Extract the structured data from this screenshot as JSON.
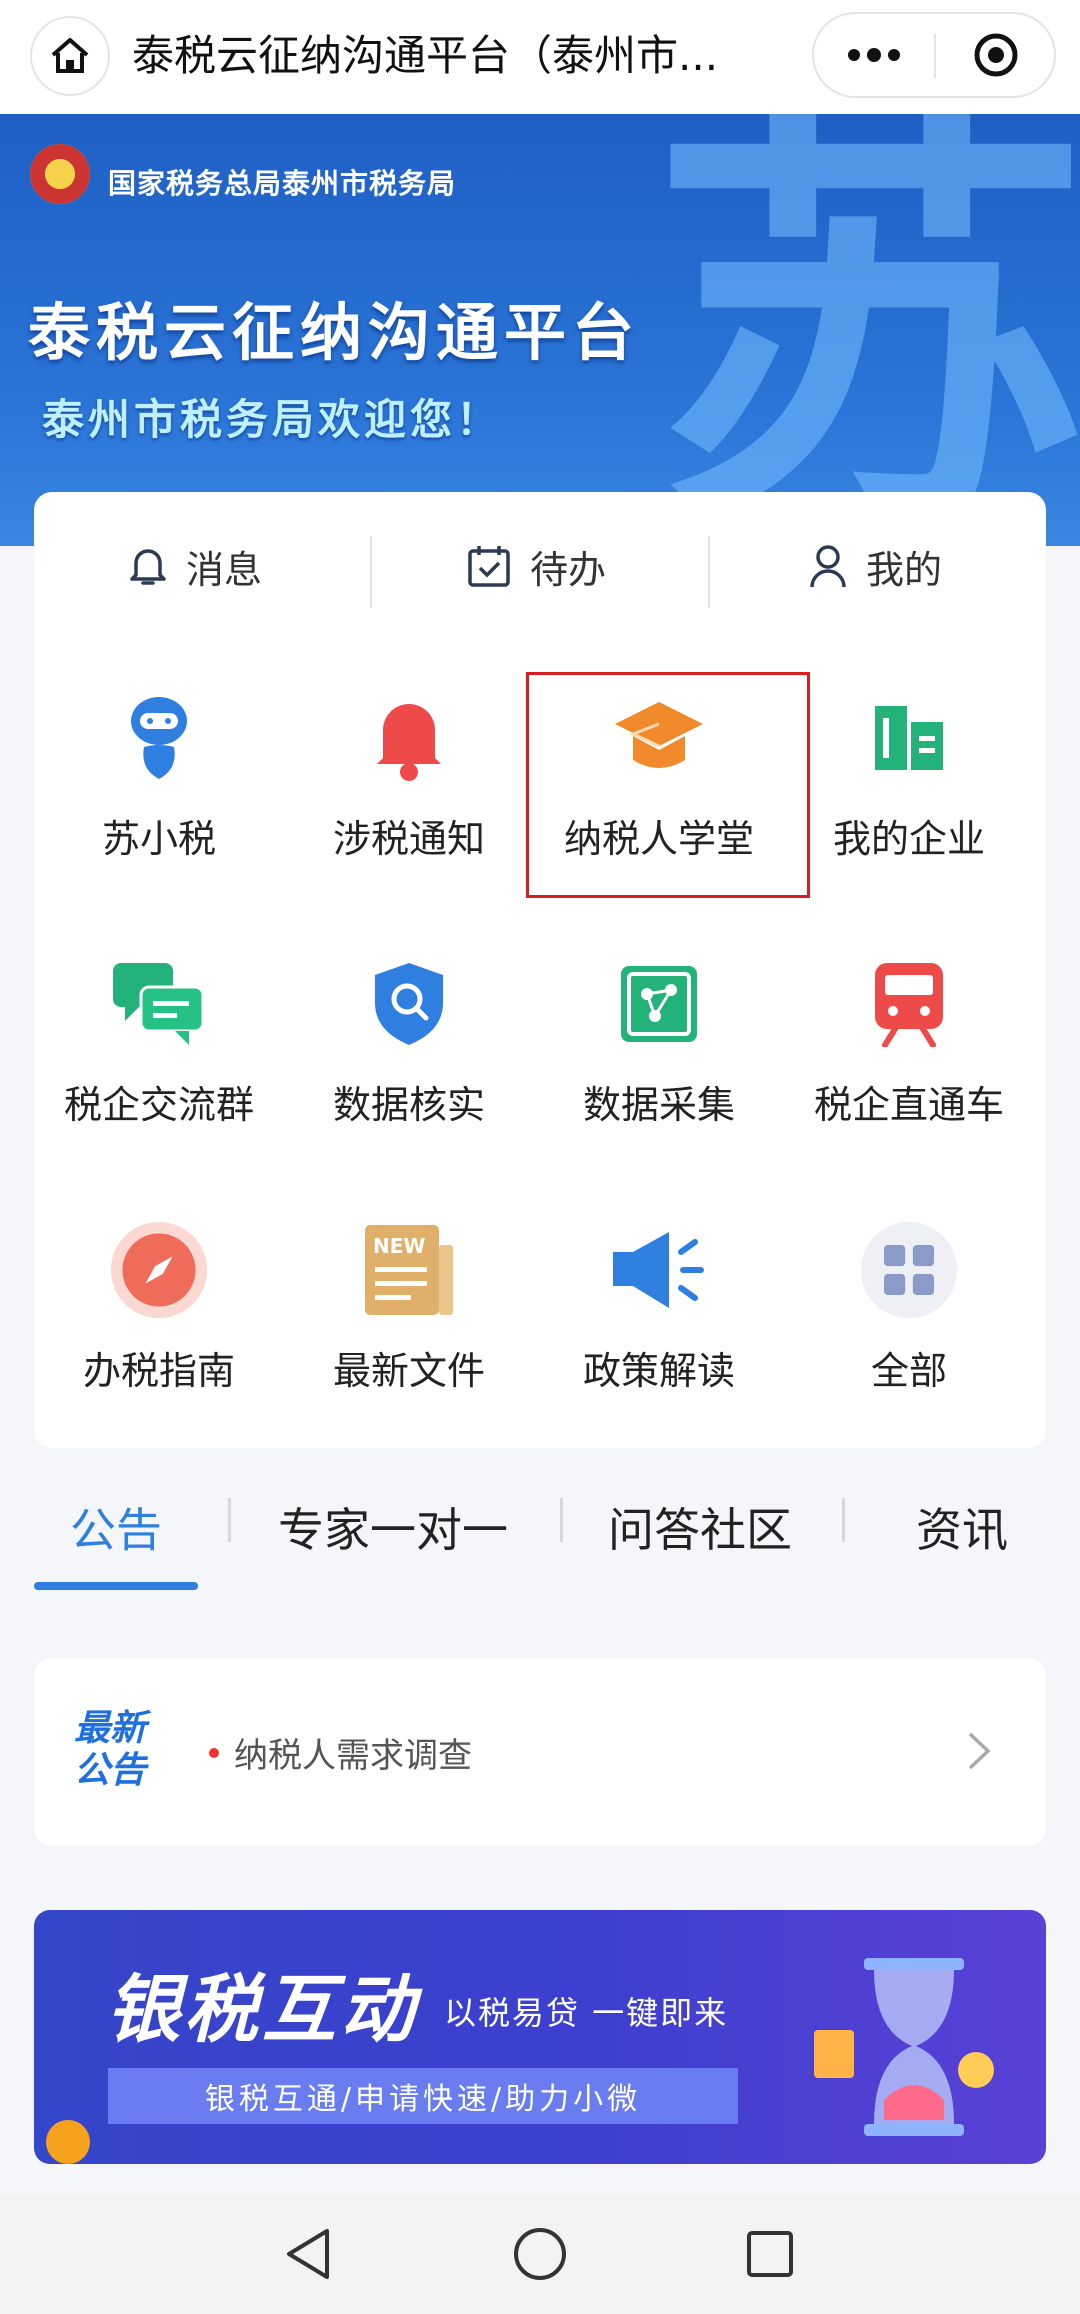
{
  "topbar": {
    "title": "泰税云征纳沟通平台（泰州市..."
  },
  "banner": {
    "bureau": "国家税务总局泰州市税务局",
    "title": "泰税云征纳沟通平台",
    "subtitle": "泰州市税务局欢迎您！",
    "big_char": "苏"
  },
  "quick_tabs": [
    {
      "label": "消息",
      "icon": "bell-icon"
    },
    {
      "label": "待办",
      "icon": "calendar-check-icon"
    },
    {
      "label": "我的",
      "icon": "user-icon"
    }
  ],
  "grid": [
    {
      "label": "苏小税",
      "icon": "robot-icon",
      "color": "#2f7fe0"
    },
    {
      "label": "涉税通知",
      "icon": "bell-icon",
      "color": "#ef4a4a"
    },
    {
      "label": "纳税人学堂",
      "icon": "graduation-cap-icon",
      "color": "#f08a2a"
    },
    {
      "label": "我的企业",
      "icon": "buildings-icon",
      "color": "#22b27a"
    },
    {
      "label": "税企交流群",
      "icon": "chat-bubbles-icon",
      "color": "#22b27a"
    },
    {
      "label": "数据核实",
      "icon": "shield-search-icon",
      "color": "#2f7fe0"
    },
    {
      "label": "数据采集",
      "icon": "data-nodes-icon",
      "color": "#22b27a"
    },
    {
      "label": "税企直通车",
      "icon": "train-icon",
      "color": "#ef4a4a"
    },
    {
      "label": "办税指南",
      "icon": "compass-icon",
      "color": "#ef6b5a"
    },
    {
      "label": "最新文件",
      "icon": "newspaper-icon",
      "color": "#e0b06a"
    },
    {
      "label": "政策解读",
      "icon": "megaphone-icon",
      "color": "#2f7fe0"
    },
    {
      "label": "全部",
      "icon": "grid-icon",
      "color": "#9aa8c9"
    }
  ],
  "tabs": [
    {
      "label": "公告",
      "active": true
    },
    {
      "label": "专家一对一",
      "active": false
    },
    {
      "label": "问答社区",
      "active": false
    },
    {
      "label": "资讯",
      "active": false
    }
  ],
  "notice": {
    "badge_line1": "最新",
    "badge_line2": "公告",
    "text": "纳税人需求调查"
  },
  "promo": {
    "title": "银税互动",
    "subtitle": "以税易贷  一键即来",
    "bar": "银税互通/申请快速/助力小微"
  }
}
